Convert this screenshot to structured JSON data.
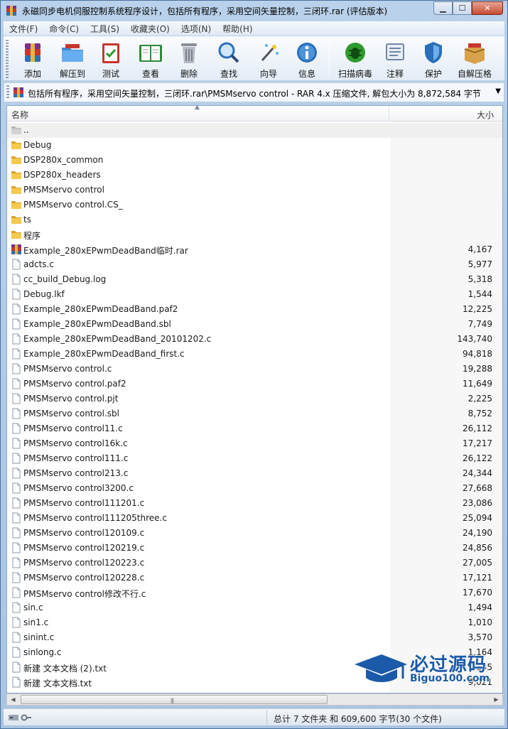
{
  "window": {
    "title": "永磁同步电机伺服控制系统程序设计，包括所有程序，采用空间矢量控制，三闭环.rar (评估版本)"
  },
  "menu": [
    "文件(F)",
    "命令(C)",
    "工具(S)",
    "收藏夹(O)",
    "选项(N)",
    "帮助(H)"
  ],
  "toolbar": {
    "add": "添加",
    "extract": "解压到",
    "test": "测试",
    "view": "查看",
    "delete": "删除",
    "find": "查找",
    "wizard": "向导",
    "info": "信息",
    "virus_scan": "扫描病毒",
    "comment": "注释",
    "protect": "保护",
    "sfx": "自解压格"
  },
  "address": {
    "path": "包括所有程序，采用空间矢量控制，三闭环.rar\\PMSMservo control - RAR 4.x 压缩文件, 解包大小为 8,872,584 字节"
  },
  "columns": {
    "name": "名称",
    "size": "大小"
  },
  "files": [
    {
      "name": "..",
      "size": "",
      "type": "up"
    },
    {
      "name": "Debug",
      "size": "",
      "type": "folder"
    },
    {
      "name": "DSP280x_common",
      "size": "",
      "type": "folder"
    },
    {
      "name": "DSP280x_headers",
      "size": "",
      "type": "folder"
    },
    {
      "name": "PMSMservo control",
      "size": "",
      "type": "folder"
    },
    {
      "name": "PMSMservo control.CS_",
      "size": "",
      "type": "folder"
    },
    {
      "name": "ts",
      "size": "",
      "type": "folder"
    },
    {
      "name": "程序",
      "size": "",
      "type": "folder"
    },
    {
      "name": "Example_280xEPwmDeadBand临时.rar",
      "size": "4,167",
      "type": "rar"
    },
    {
      "name": "adcts.c",
      "size": "5,977",
      "type": "file"
    },
    {
      "name": "cc_build_Debug.log",
      "size": "5,318",
      "type": "file"
    },
    {
      "name": "Debug.lkf",
      "size": "1,544",
      "type": "file"
    },
    {
      "name": "Example_280xEPwmDeadBand.paf2",
      "size": "12,225",
      "type": "file"
    },
    {
      "name": "Example_280xEPwmDeadBand.sbl",
      "size": "7,749",
      "type": "file"
    },
    {
      "name": "Example_280xEPwmDeadBand_20101202.c",
      "size": "143,740",
      "type": "file"
    },
    {
      "name": "Example_280xEPwmDeadBand_first.c",
      "size": "94,818",
      "type": "file"
    },
    {
      "name": "PMSMservo control.c",
      "size": "19,288",
      "type": "file"
    },
    {
      "name": "PMSMservo control.paf2",
      "size": "11,649",
      "type": "file"
    },
    {
      "name": "PMSMservo control.pjt",
      "size": "2,225",
      "type": "file"
    },
    {
      "name": "PMSMservo control.sbl",
      "size": "8,752",
      "type": "file"
    },
    {
      "name": "PMSMservo control11.c",
      "size": "26,112",
      "type": "file"
    },
    {
      "name": "PMSMservo control16k.c",
      "size": "17,217",
      "type": "file"
    },
    {
      "name": "PMSMservo control111.c",
      "size": "26,122",
      "type": "file"
    },
    {
      "name": "PMSMservo control213.c",
      "size": "24,344",
      "type": "file"
    },
    {
      "name": "PMSMservo control3200.c",
      "size": "27,668",
      "type": "file"
    },
    {
      "name": "PMSMservo control111201.c",
      "size": "23,086",
      "type": "file"
    },
    {
      "name": "PMSMservo control111205three.c",
      "size": "25,094",
      "type": "file"
    },
    {
      "name": "PMSMservo control120109.c",
      "size": "24,190",
      "type": "file"
    },
    {
      "name": "PMSMservo control120219.c",
      "size": "24,856",
      "type": "file"
    },
    {
      "name": "PMSMservo control120223.c",
      "size": "27,005",
      "type": "file"
    },
    {
      "name": "PMSMservo control120228.c",
      "size": "17,121",
      "type": "file"
    },
    {
      "name": "PMSMservo control修改不行.c",
      "size": "17,670",
      "type": "file"
    },
    {
      "name": "sin.c",
      "size": "1,494",
      "type": "file"
    },
    {
      "name": "sin1.c",
      "size": "1,010",
      "type": "file"
    },
    {
      "name": "sinint.c",
      "size": "3,570",
      "type": "file"
    },
    {
      "name": "sinlong.c",
      "size": "1,164",
      "type": "file"
    },
    {
      "name": "新建 文本文档 (2).txt",
      "size": "1,135",
      "type": "file"
    },
    {
      "name": "新建 文本文档.txt",
      "size": "9,021",
      "type": "file"
    }
  ],
  "status": {
    "summary": "总计 7 文件夹 和 609,600 字节(30 个文件)"
  },
  "watermark": {
    "main": "必过源码",
    "sub": "Biguo100.com"
  },
  "colors": {
    "folder": "#e8b93a",
    "accent": "#1b5aa8"
  }
}
